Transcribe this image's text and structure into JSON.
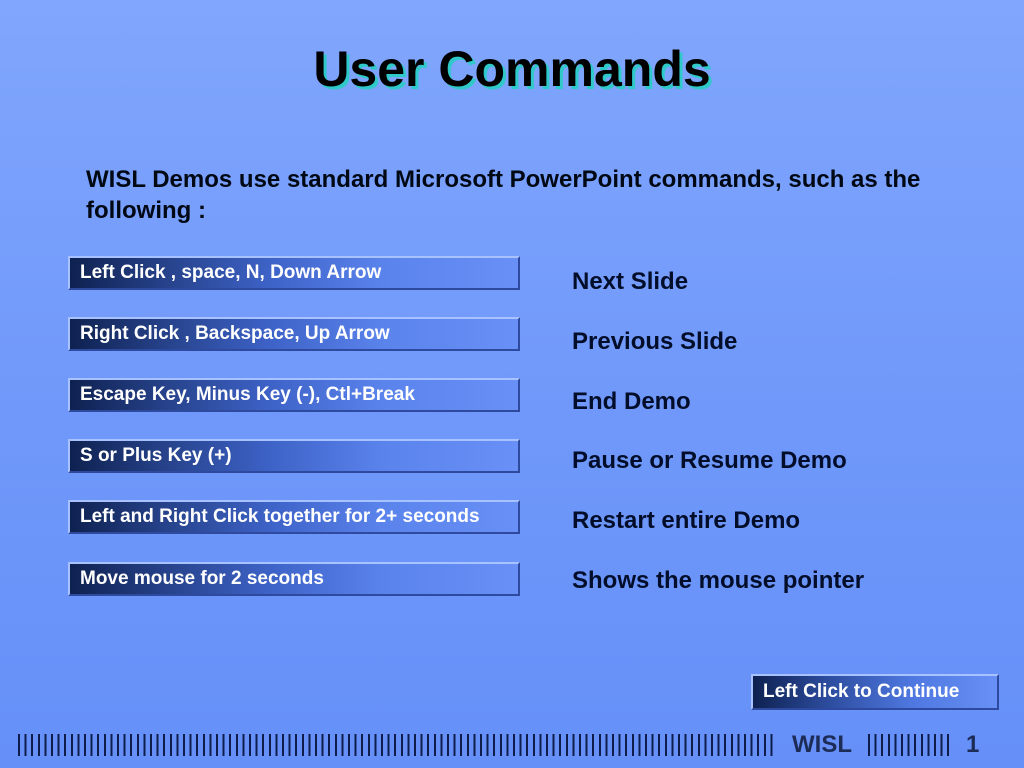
{
  "slide": {
    "title": "User Commands",
    "intro": "WISL Demos use standard Microsoft PowerPoint commands, such as the following :",
    "commands": [
      {
        "keys": "Left Click , space, N,  Down Arrow",
        "action": "Next Slide"
      },
      {
        "keys": "Right Click , Backspace, Up Arrow",
        "action": "Previous Slide"
      },
      {
        "keys": "Escape Key, Minus Key (-), Ctl+Break",
        "action": "End Demo"
      },
      {
        "keys": "S or Plus Key (+)",
        "action": "Pause or Resume Demo"
      },
      {
        "keys": "Left and Right Click together for 2+ seconds",
        "action": "Restart entire Demo"
      },
      {
        "keys": "Move mouse for 2 seconds",
        "action": "Shows the mouse pointer"
      }
    ],
    "continue_label": "Left Click to Continue"
  },
  "footer": {
    "brand": "WISL",
    "page_number": "1"
  },
  "colors": {
    "background_top": "#80a6fd",
    "background_bottom": "#6590f8",
    "title_shadow": "#2fc9c9",
    "bar_dark": "#0e2150",
    "bar_light": "#6890f6"
  }
}
